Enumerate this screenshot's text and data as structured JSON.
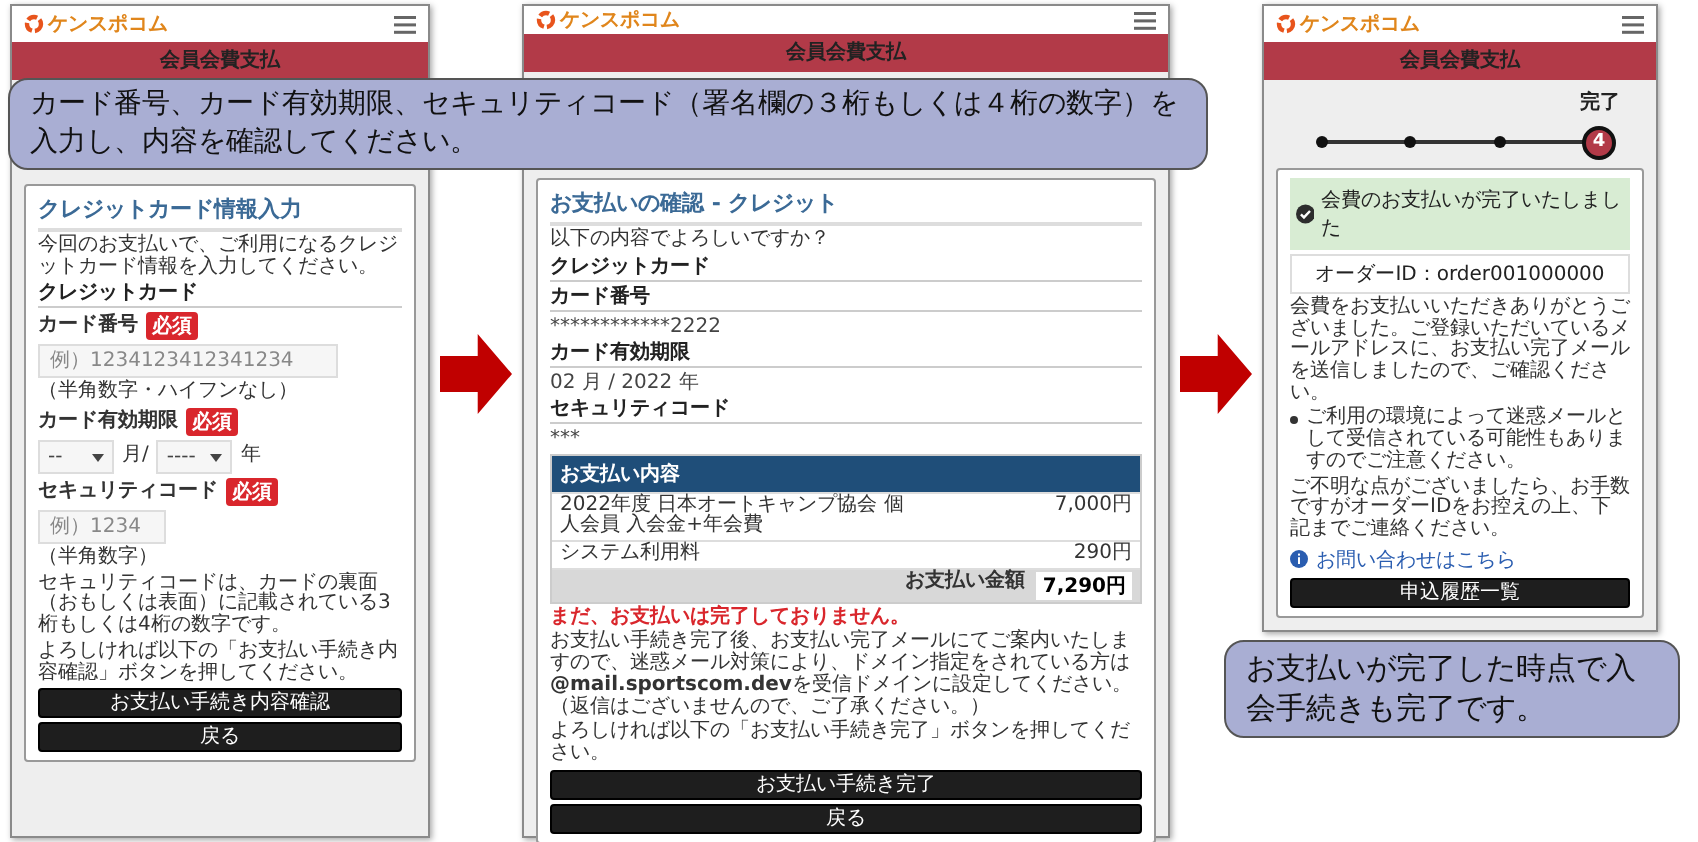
{
  "callouts": [
    {
      "kind": "top",
      "text": "カード番号、カード有効期限、セキュリティコード（署名欄の３桁もしくは４桁の数字）を入力し、内容を確認してください。"
    },
    {
      "kind": "bottom",
      "text": "お支払いが完了した時点で入会手続きも完了です。"
    }
  ],
  "phones": [
    {
      "kind": "input",
      "logo": "ケンスポコム",
      "header": "会員会費支払",
      "heading": "クレジットカード情報入力",
      "intro": "今回のお支払いで、ご利用になるクレジットカード情報を入力してください。",
      "section": "クレジットカード",
      "card_number": {
        "label": "カード番号",
        "badge": "必須",
        "placeholder": "例）1234123412341234",
        "hint": "（半角数字・ハイフンなし）"
      },
      "expiry": {
        "label": "カード有効期限",
        "badge": "必須",
        "month": "--",
        "month_unit": "月/",
        "year": "----",
        "year_unit": "年"
      },
      "security": {
        "label": "セキュリティコード",
        "badge": "必須",
        "placeholder": "例）1234",
        "hint": "（半角数字）",
        "note": "セキュリティコードは、カードの裏面（おもしくは表面）に記載されている3桁もしくは4桁の数字です。"
      },
      "instruction": "よろしければ以下の「お支払い手続き内容確認」ボタンを押してください。",
      "buttons": [
        "お支払い手続き内容確認",
        "戻る"
      ]
    },
    {
      "kind": "confirm",
      "logo": "ケンスポコム",
      "header": "会員会費支払",
      "heading": "お支払いの確認 - クレジット",
      "intro": "以下の内容でよろしいですか？",
      "section": "クレジットカード",
      "fields": [
        {
          "label": "カード番号",
          "value": "************2222"
        },
        {
          "label": "カード有効期限",
          "value": "02 月 / 2022 年"
        },
        {
          "label": "セキュリティコード",
          "value": "***"
        }
      ],
      "table": {
        "title": "お支払い内容",
        "rows": [
          {
            "item": "2022年度 日本オートキャンプ協会 個人会員 入会金+年会費",
            "amount": "7,000円"
          },
          {
            "item": "システム利用料",
            "amount": "290円"
          }
        ],
        "total_label": "お支払い金額",
        "total": "7,290円"
      },
      "warning": "まだ、お支払いは完了しておりません。",
      "note": "お支払い手続き完了後、お支払い完了メールにてご案内いたしますので、迷惑メール対策により、ドメイン指定をされている方は**@mail.sportscom.dev**を受信ドメインに設定してください。（返信はございませんので、ご了承ください。）",
      "instruction": "よろしければ以下の「お支払い手続き完了」ボタンを押してください。",
      "buttons": [
        "お支払い手続き完了",
        "戻る"
      ]
    },
    {
      "kind": "complete",
      "logo": "ケンスポコム",
      "header": "会員会費支払",
      "stepper": {
        "label": "完了",
        "steps": [
          {
            "selected": false
          },
          {
            "selected": false
          },
          {
            "selected": false
          },
          {
            "selected": true,
            "number": "4"
          }
        ]
      },
      "success": "会費のお支払いが完了いたしました",
      "order": "オーダーID：order001000000",
      "message": "会費をお支払いいただきありがとうございました。ご登録いただいているメールアドレスに、お支払い完了メールを送信しましたので、ご確認ください。",
      "bullet": "ご利用の環境によって迷惑メールとして受信されている可能性もありますのでご注意ください。",
      "contact": "ご不明な点がございましたら、お手数ですがオーダーIDをお控えの上、下記までご連絡ください。",
      "link": "お問い合わせはこちら",
      "buttons": [
        "申込履歴一覧"
      ]
    }
  ]
}
